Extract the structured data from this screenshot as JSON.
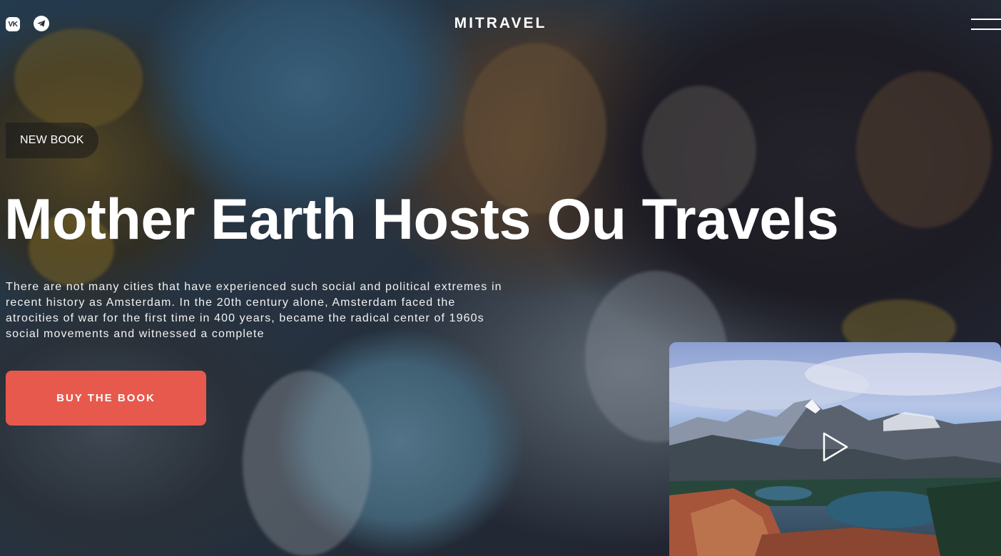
{
  "header": {
    "brand": "MITRAVEL",
    "social": [
      {
        "name": "vk-icon",
        "glyph": "vk"
      },
      {
        "name": "telegram-icon",
        "glyph": "telegram"
      }
    ],
    "menu_icon": "hamburger-menu-icon"
  },
  "hero": {
    "badge": "NEW BOOK",
    "headline": "Mother Earth Hosts Ou Travels",
    "description": "There are not many cities that have experienced such social and political extremes in recent history as Amsterdam. In the 20th century alone, Amsterdam faced the atrocities of war for the first time in 400 years, became the radical center of 1960s social movements and witnessed a complete",
    "buy_button": "BUY THE BOOK",
    "buy_button_color": "#e8594d"
  },
  "video": {
    "play_icon": "play-icon"
  }
}
